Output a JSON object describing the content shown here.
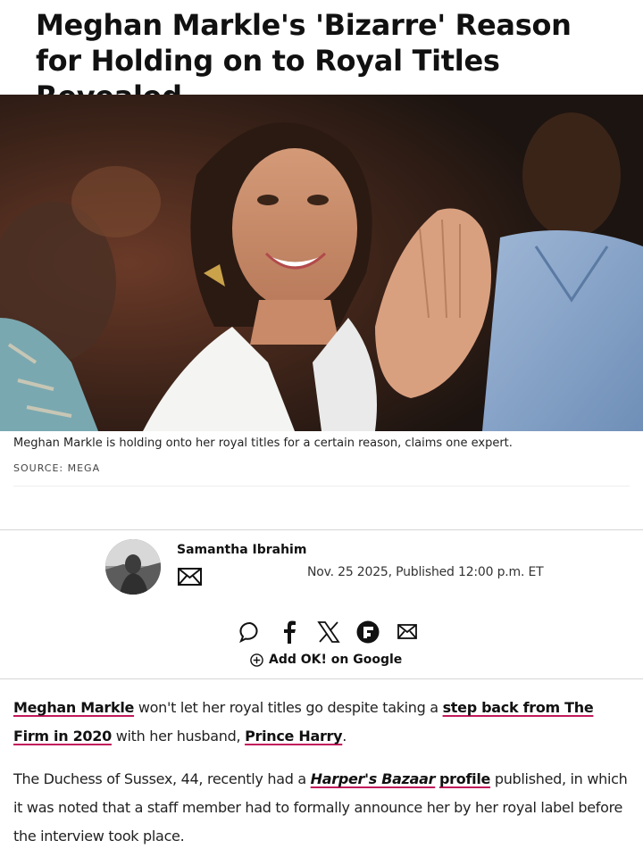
{
  "article": {
    "headline": "Meghan Markle's 'Bizarre' Reason for Holding on to Royal Titles Revealed",
    "image_caption": "Meghan Markle is holding onto her royal titles for a certain reason, claims one expert.",
    "image_source": "SOURCE: MEGA"
  },
  "byline": {
    "author": "Samantha Ibrahim",
    "date": "Nov. 25 2025, Published 12:00 p.m. ET"
  },
  "share": {
    "icons": [
      "comment-icon",
      "facebook-icon",
      "x-icon",
      "flipboard-icon",
      "mail-icon"
    ],
    "google_label": "Add OK! on Google"
  },
  "body": {
    "p1": {
      "link1": "Meghan Markle",
      "text1": " won't let her royal titles go despite taking a ",
      "link2": "step back from The Firm in 2020",
      "text2": " with her husband, ",
      "link3": "Prince Harry",
      "text3": "."
    },
    "p2": {
      "text1": "The Duchess of Sussex, 44, recently had a ",
      "link1": "Harper's Bazaar",
      "space": " ",
      "link2": "profile",
      "text2": " published, in which it was noted that a staff member had to formally announce her by her royal label before the interview took place."
    }
  },
  "colors": {
    "link_underline": "#c2185b",
    "rule": "#d6d6d6"
  }
}
